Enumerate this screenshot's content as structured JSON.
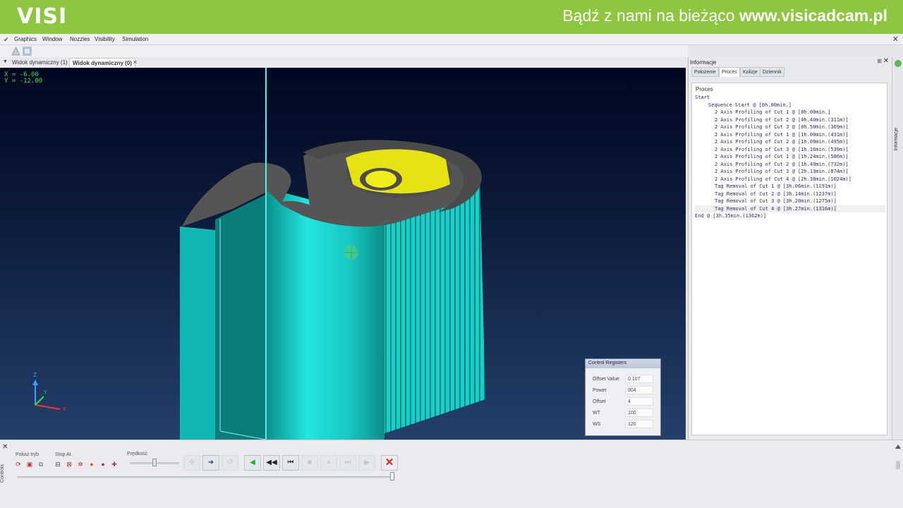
{
  "banner": {
    "logo": "VISI",
    "tagline_plain": "Bądź z nami na bieżąco ",
    "tagline_bold": "www.visicadcam.pl"
  },
  "menu": [
    "Graphics",
    "Window",
    "Nozzles",
    "Visibility",
    "Simulation"
  ],
  "tabs": [
    {
      "label": "Widok dynamiczny (1)",
      "active": false
    },
    {
      "label": "Widok dynamiczny (0)",
      "active": true
    }
  ],
  "viewport": {
    "coord_x": "X = -6.00",
    "coord_y": "Y = -12.00",
    "axis_z": "Z",
    "axis_y": "Y",
    "axis_x": "X",
    "colors": {
      "part": "#1fe3dc",
      "top_face": "#5a5a5a",
      "hole": "#e7e214"
    }
  },
  "control_registers": {
    "title": "Control Registers",
    "rows": [
      {
        "label": "Offset Value",
        "value": "0.107"
      },
      {
        "label": "Power",
        "value": "904"
      },
      {
        "label": "Offset",
        "value": "4"
      },
      {
        "label": "WT",
        "value": "100"
      },
      {
        "label": "WS",
        "value": "120"
      }
    ]
  },
  "info_panel": {
    "title": "Informacje",
    "side_label": "Informacje",
    "tabs": [
      {
        "label": "Położenie",
        "active": false
      },
      {
        "label": "Proces",
        "active": true
      },
      {
        "label": "Kolizje",
        "active": false
      },
      {
        "label": "Dziennik",
        "active": false
      }
    ],
    "section_title": "Proces",
    "lines": [
      {
        "text": "Start",
        "indent": 0
      },
      {
        "text": "Sequence Start @ [0h.00min.]",
        "indent": 1
      },
      {
        "text": "2 Axis Profiling of Cut 1 @ [0h.00min.]",
        "indent": 2
      },
      {
        "text": "2 Axis Profiling of Cut 2 @ [0h.40min.(311m)]",
        "indent": 2
      },
      {
        "text": "2 Axis Profiling of Cut 3 @ [0h.50min.(369m)]",
        "indent": 2
      },
      {
        "text": "2 Axis Profiling of Cut 1 @ [1h.00min.(431m)]",
        "indent": 2
      },
      {
        "text": "2 Axis Profiling of Cut 2 @ [1h.09min.(495m)]",
        "indent": 2
      },
      {
        "text": "2 Axis Profiling of Cut 3 @ [1h.16min.(539m)]",
        "indent": 2
      },
      {
        "text": "2 Axis Profiling of Cut 1 @ [1h.24min.(586m)]",
        "indent": 2
      },
      {
        "text": "2 Axis Profiling of Cut 2 @ [1h.49min.(732m)]",
        "indent": 2
      },
      {
        "text": "2 Axis Profiling of Cut 3 @ [2h.13min.(874m)]",
        "indent": 2
      },
      {
        "text": "2 Axis Profiling of Cut 4 @ [2h.38min.(1024m)]",
        "indent": 2
      },
      {
        "text": "Tag Removal of Cut 1 @ [3h.06min.(1191m)]",
        "indent": 2
      },
      {
        "text": "Tag Removal of Cut 2 @ [3h.14min.(1237m)]",
        "indent": 2
      },
      {
        "text": "Tag Removal of Cut 3 @ [3h.20min.(1275m)]",
        "indent": 2
      },
      {
        "text": "Tag Removal of Cut 4 @ [3h.27min.(1316m)]",
        "indent": 2,
        "selected": true
      },
      {
        "text": "End @ [3h.35min.(1362m)]",
        "indent": 0
      }
    ]
  },
  "controls": {
    "side_label": "Controls",
    "show_mode_label": "Pokaż tryb",
    "stop_at_label": "Stop At",
    "speed_label": "Prędkość"
  }
}
